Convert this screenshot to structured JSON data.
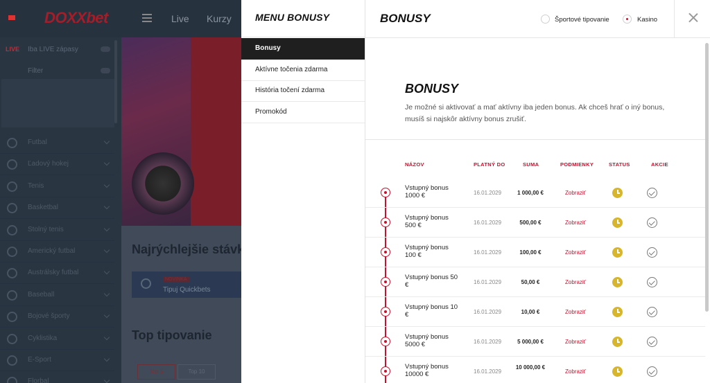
{
  "background": {
    "brand": "DOXXbet",
    "nav": [
      "Live",
      "Kurzy"
    ],
    "live_badge": "LIVE",
    "live_toggle_label": "Iba LIVE zápasy",
    "filter_label": "Filter",
    "sports": [
      "Futbal",
      "Ľadový hokej",
      "Tenis",
      "Basketbal",
      "Stolný tenis",
      "Americký futbal",
      "Austrálsky futbal",
      "Baseball",
      "Bojové športy",
      "Cyklistika",
      "E-Sport",
      "Florbal"
    ],
    "headline_quick": "Najrýchlejšie stávky",
    "quick_badge": "NOVINKA",
    "quick_label": "Tipuj Quickbets",
    "headline_top": "Top tipovanie",
    "tabs": [
      "Top 5",
      "Top 10"
    ]
  },
  "menu": {
    "title": "MENU BONUSY",
    "items": [
      {
        "label": "Bonusy",
        "active": true
      },
      {
        "label": "Aktívne točenia zdarma",
        "active": false
      },
      {
        "label": "História točení zdarma",
        "active": false
      },
      {
        "label": "Promokód",
        "active": false
      }
    ]
  },
  "bonus": {
    "header_title": "BONUSY",
    "radio_sport": "Športové tipovanie",
    "radio_casino": "Kasino",
    "selected": "casino",
    "title": "BONUSY",
    "description": "Je možné si aktivovať a mať aktívny iba jeden bonus. Ak chceš hrať o iný bonus, musíš si najskôr aktívny bonus zrušiť.",
    "columns": {
      "name": "NÁZOV",
      "valid_until": "PLATNÝ DO",
      "amount": "SUMA",
      "conditions": "PODMIENKY",
      "status": "STATUS",
      "action": "AKCIE"
    },
    "rows": [
      {
        "name": "Vstupný bonus 1000 €",
        "valid": "16.01.2029",
        "amount": "1 000,00 €",
        "link": "Zobraziť"
      },
      {
        "name": "Vstupný bonus 500 €",
        "valid": "16.01.2029",
        "amount": "500,00 €",
        "link": "Zobraziť"
      },
      {
        "name": "Vstupný bonus 100 €",
        "valid": "16.01.2029",
        "amount": "100,00 €",
        "link": "Zobraziť"
      },
      {
        "name": "Vstupný bonus 50 €",
        "valid": "16.01.2029",
        "amount": "50,00 €",
        "link": "Zobraziť"
      },
      {
        "name": "Vstupný bonus 10 €",
        "valid": "16.01.2029",
        "amount": "10,00 €",
        "link": "Zobraziť"
      },
      {
        "name": "Vstupný bonus 5000 €",
        "valid": "16.01.2029",
        "amount": "5 000,00 €",
        "link": "Zobraziť"
      },
      {
        "name": "Vstupný bonus 10000 €",
        "valid": "16.01.2029",
        "amount": "10 000,00 €",
        "link": "Zobraziť"
      }
    ]
  },
  "colors": {
    "accent": "#c8102e",
    "status": "#d7b52c"
  },
  "icons": {
    "status": "clock-icon",
    "action": "check-circle-icon",
    "close": "close-icon"
  }
}
